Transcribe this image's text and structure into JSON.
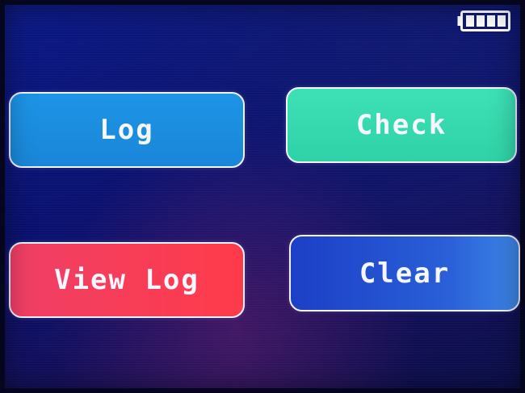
{
  "status_bar": {
    "battery_icon": "battery-full-icon",
    "battery_level": 1.0,
    "battery_bars": 4
  },
  "buttons": {
    "log_label": "Log",
    "check_label": "Check",
    "view_log_label": "View Log",
    "clear_label": "Clear"
  },
  "colors": {
    "background": "#0a1170",
    "log": "#1d94e6",
    "check": "#3ee1b6",
    "view_log": "#ff3b4a",
    "clear": "#2a60d8",
    "border": "#f2f4ff"
  }
}
